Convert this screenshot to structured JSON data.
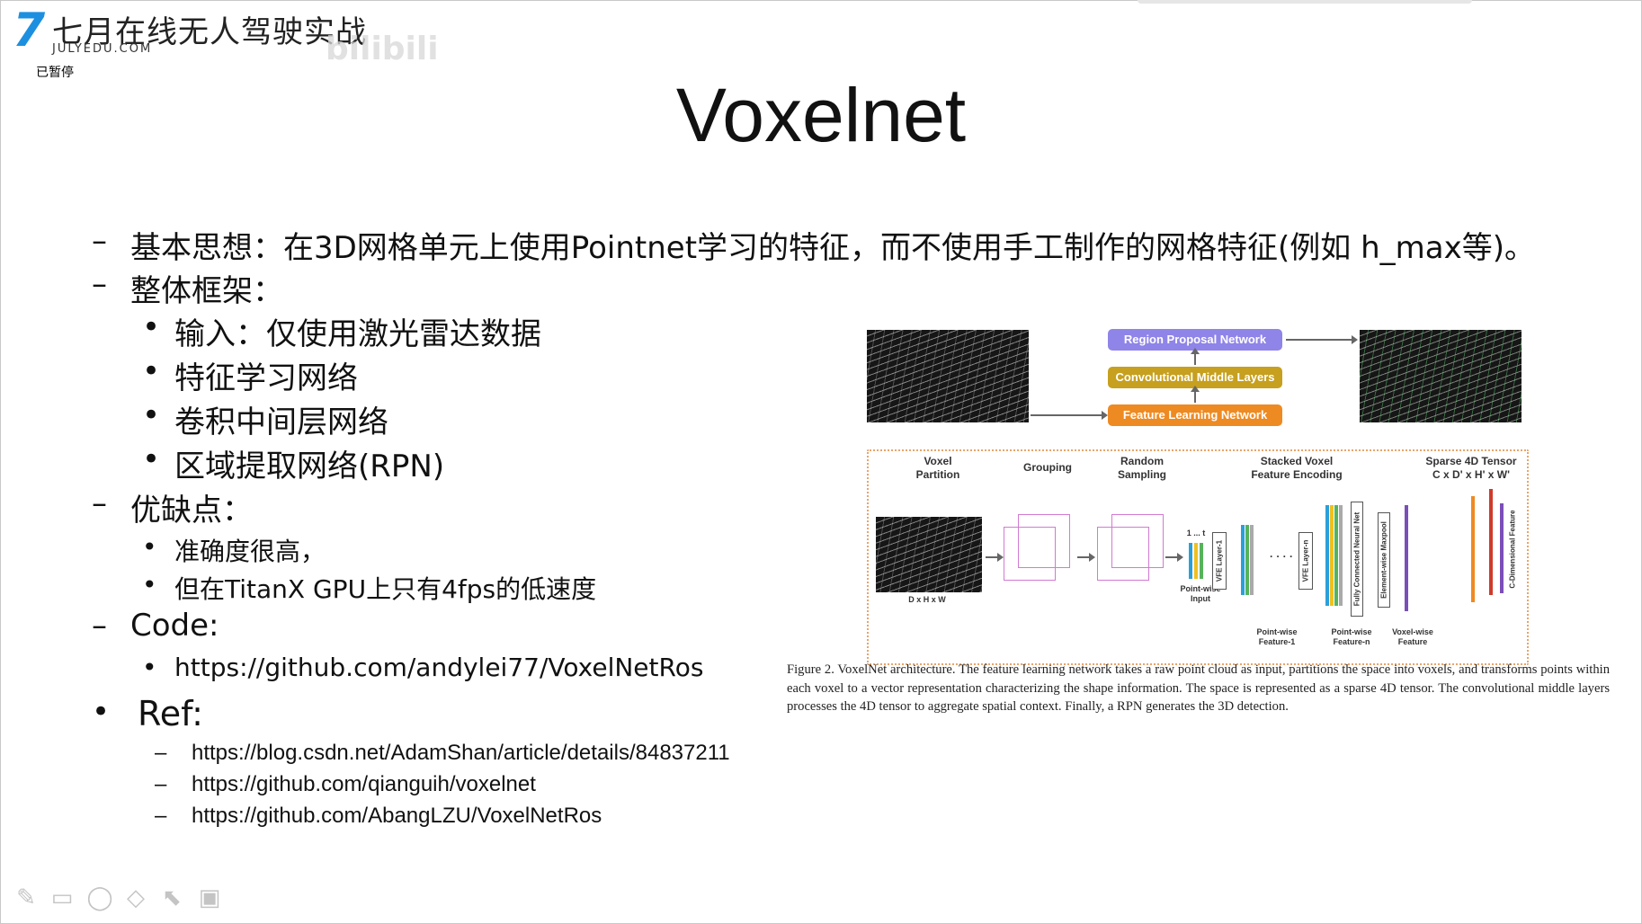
{
  "watermark": {
    "logo_glyph": "7",
    "logo_title": "七月在线无人驾驶实战",
    "logo_sub": "JULYEDU.COM",
    "blurred_text": "bilibili",
    "status": "已暂停"
  },
  "slide": {
    "title": "Voxelnet",
    "dash": "–",
    "dot": "•",
    "items": {
      "idea": "基本思想：在3D网格单元上使用Pointnet学习的特征，而不使用手工制作的网格特征(例如 h_max等)。",
      "framework": "整体框架：",
      "framework_items": [
        "输入：仅使用激光雷达数据",
        "特征学习网络",
        "卷积中间层网络",
        "区域提取网络(RPN)"
      ],
      "pros_cons": "优缺点：",
      "pros_cons_items": [
        "准确度很高，",
        "但在TitanX GPU上只有4fps的低速度"
      ],
      "code": "Code:",
      "code_link": "https://github.com/andylei77/VoxelNetRos",
      "ref": "Ref:",
      "ref_links": [
        "https://blog.csdn.net/AdamShan/article/details/84837211",
        "https://github.com/qianguih/voxelnet",
        "https://github.com/AbangLZU/VoxelNetRos"
      ]
    }
  },
  "figure": {
    "rpn": "Region Proposal Network",
    "cml": "Convolutional Middle Layers",
    "fln": "Feature Learning Network",
    "voxel_partition": "Voxel\nPartition",
    "grouping": "Grouping",
    "random_sampling": "Random\nSampling",
    "stacked": "Stacked Voxel\nFeature Encoding",
    "sparse": "Sparse 4D Tensor\nC x D' x H' x W'",
    "dhw": "D x H x W",
    "one_t": "1 ... t",
    "pointwise_input": "Point-wise\nInput",
    "pwf1": "Point-wise\nFeature-1",
    "pwfn": "Point-wise\nFeature-n",
    "voxelwise": "Voxel-wise\nFeature",
    "vfe1": "VFE Layer-1",
    "vfen": "VFE Layer-n",
    "fcn": "Fully Connected Neural Net",
    "maxpool": "Element-wise Maxpool",
    "cdim": "C-Dimensional Feature",
    "dots": "· · · ·",
    "caption": "Figure 2. VoxelNet architecture. The feature learning network takes a raw point cloud as input, partitions the space into voxels, and transforms points within each voxel to a vector representation characterizing the shape information. The space is represented as a sparse 4D tensor. The convolutional middle layers processes the 4D tensor to aggregate spatial context. Finally, a RPN generates the 3D detection."
  },
  "tools": {
    "pen": "✎",
    "rect": "▭",
    "lasso": "◯",
    "eraser": "◇",
    "pointer": "⬉",
    "camera": "▣"
  },
  "colors": {
    "logo_blue": "#1d8fe0",
    "rpn": "#8f84e8",
    "cml": "#c6a01e",
    "fln": "#ee8a22"
  }
}
